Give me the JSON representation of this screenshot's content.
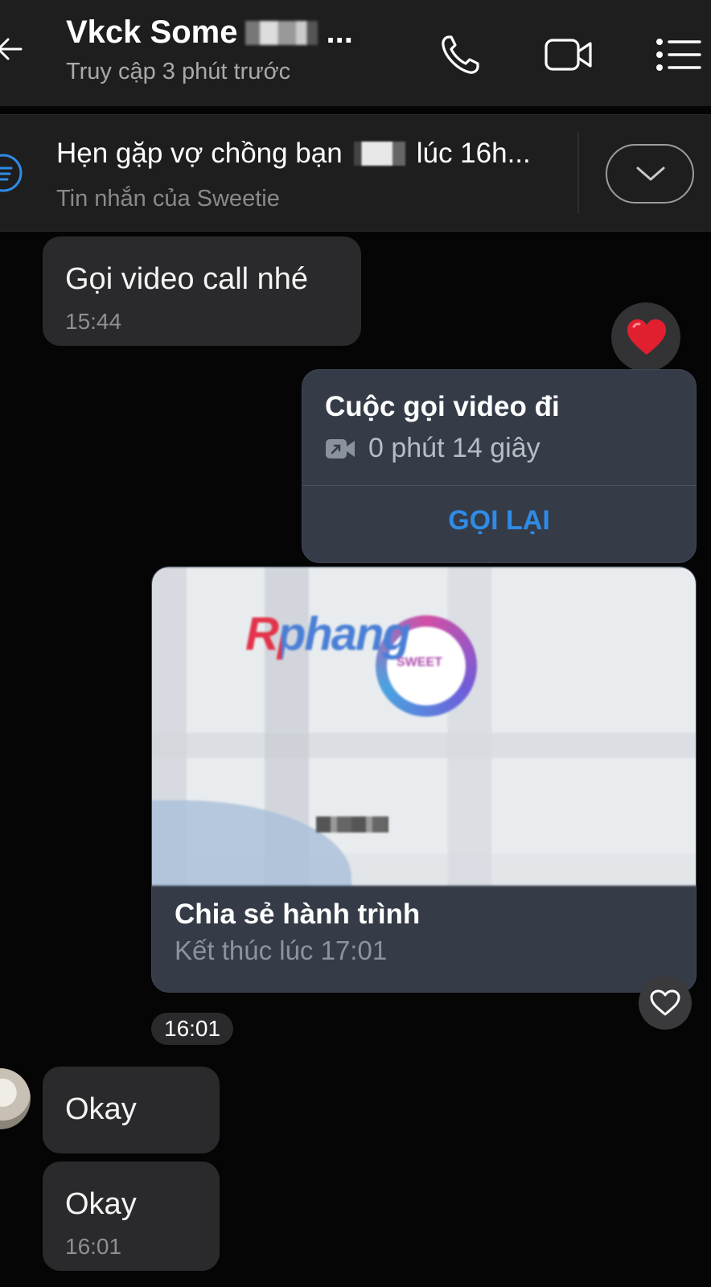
{
  "header": {
    "title": "Vkck Some",
    "title_suffix": "...",
    "status": "Truy cập 3 phút trước",
    "icons": [
      "back-arrow-icon",
      "phone-icon",
      "video-camera-icon",
      "menu-icon"
    ]
  },
  "pinned": {
    "title_start": "Hẹn gặp vợ chồng bạn",
    "title_end": "lúc 16h...",
    "subtitle": "Tin nhắn của Sweetie",
    "icons": [
      "pinned-message-icon",
      "chevron-down-icon"
    ]
  },
  "messages": [
    {
      "type": "incoming_text",
      "text": "Gọi video call nhé",
      "time": "15:44",
      "reaction": "heart-icon"
    },
    {
      "type": "outgoing_call",
      "title": "Cuộc gọi video đi",
      "duration": "0 phút 14 giây",
      "action": "GỌI LẠI"
    },
    {
      "type": "outgoing_share",
      "brand": "Rphang",
      "brand_sub": "SWEET",
      "title": "Chia sẻ hành trình",
      "subtitle": "Kết thúc lúc 17:01"
    },
    {
      "type": "time_separator",
      "time": "16:01"
    },
    {
      "type": "incoming_text",
      "text": "Okay"
    },
    {
      "type": "incoming_text",
      "text": "Okay",
      "time": "16:01"
    }
  ],
  "colors": {
    "background": "#050505",
    "header": "#1e1e1f",
    "incoming_bubble": "#2a2a2c",
    "outgoing_card": "#353c48",
    "accent_blue": "#2f8be6",
    "reaction_red": "#e0202e"
  }
}
